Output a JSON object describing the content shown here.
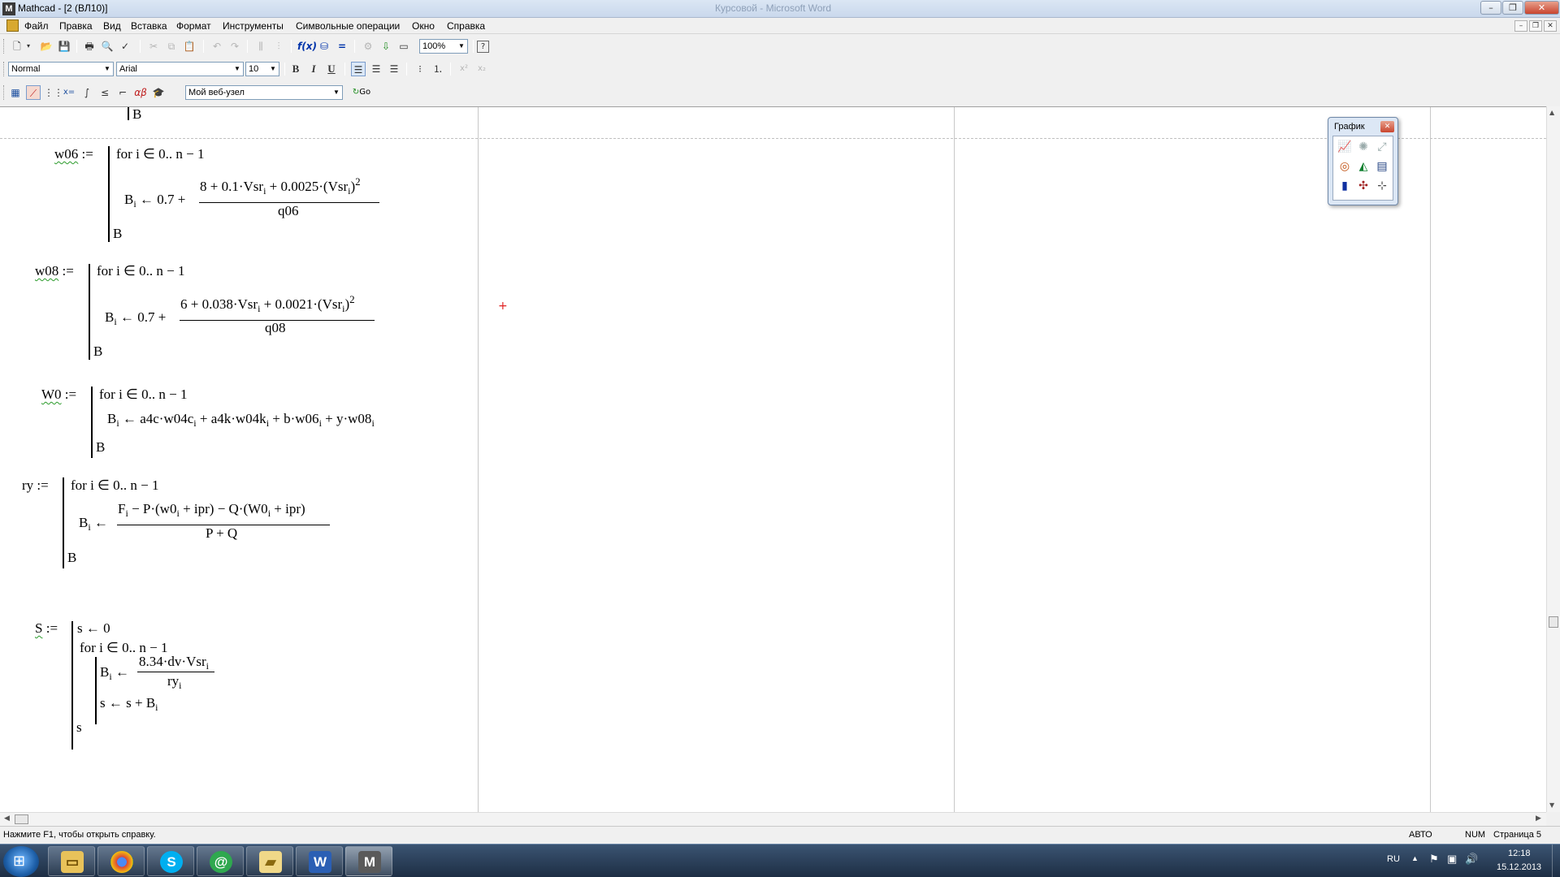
{
  "window": {
    "title": "Mathcad - [2 (ВЛ10)]",
    "background_title": "Курсовой - Microsoft Word",
    "minimize": "–",
    "restore": "❐",
    "close": "✕"
  },
  "menu": {
    "items": [
      "Файл",
      "Правка",
      "Вид",
      "Вставка",
      "Формат",
      "Инструменты",
      "Символьные операции",
      "Окно",
      "Справка"
    ],
    "mdi_min": "–",
    "mdi_restore": "❐",
    "mdi_close": "✕"
  },
  "toolbar_standard": {
    "zoom": "100%"
  },
  "toolbar_format": {
    "style": "Normal",
    "font": "Arial",
    "size": "10",
    "bold": "B",
    "italic": "I",
    "underline": "U"
  },
  "toolbar_resources": {
    "web_combo": "Мой веб-узел",
    "go": "Go"
  },
  "worksheet": {
    "top_B": "B",
    "w06": {
      "name": "w06",
      "assign": ":=",
      "for_line": "for  i ∈ 0.. n − 1",
      "lhs": "B",
      "lhs_sub": "i",
      "arrow": "← 0.7 +",
      "numer": "8 + 0.1·Vsr",
      "numer_mid": " + 0.0025·(Vsr",
      "numer_end": ")",
      "sup": "2",
      "denom": "q06",
      "ret": "B"
    },
    "w08": {
      "name": "w08",
      "assign": ":=",
      "for_line": "for  i ∈ 0.. n − 1",
      "lhs": "B",
      "lhs_sub": "i",
      "arrow": "← 0.7 +",
      "numer": "6 + 0.038·Vsr",
      "numer_mid": " + 0.0021·(Vsr",
      "numer_end": ")",
      "sup": "2",
      "denom": "q08",
      "ret": "B"
    },
    "W0": {
      "name": "W0",
      "assign": ":=",
      "for_line": "for  i ∈ 0.. n − 1",
      "lhs": "B",
      "lhs_sub": "i",
      "expr1": "← a4c·w04c",
      "expr2": " + a4k·w04k",
      "expr3": " + b·w06",
      "expr4": " + y·w08",
      "ret": "B"
    },
    "ry": {
      "name": "ry",
      "assign": ":=",
      "for_line": "for  i ∈ 0.. n − 1",
      "lhs": "B",
      "lhs_sub": "i",
      "arrow": "←",
      "numer1": "F",
      "numer2": " − P·(w0",
      "numer3": " + ipr) − Q·(W0",
      "numer4": " + ipr)",
      "denom": "P + Q",
      "ret": "B"
    },
    "S": {
      "name": "S",
      "assign": ":=",
      "init": "s ← 0",
      "for_line": "for  i ∈ 0.. n − 1",
      "lhs": "B",
      "lhs_sub": "i",
      "arrow": "←",
      "numer": "8.34·dv·Vsr",
      "denom": "ry",
      "sum_line": "s ← s + B",
      "ret": "s"
    },
    "i_sub": "i"
  },
  "graph_palette": {
    "title": "График",
    "close": "✕"
  },
  "status": {
    "help": "Нажмите F1, чтобы открыть справку.",
    "mode": "АВТО",
    "num": "NUM",
    "page": "Страница 5"
  },
  "tray": {
    "lang": "RU",
    "time": "12:18",
    "date": "15.12.2013"
  },
  "taskbar_apps": [
    "chrome",
    "skype",
    "mail-agent",
    "explorer",
    "word",
    "mathcad"
  ]
}
